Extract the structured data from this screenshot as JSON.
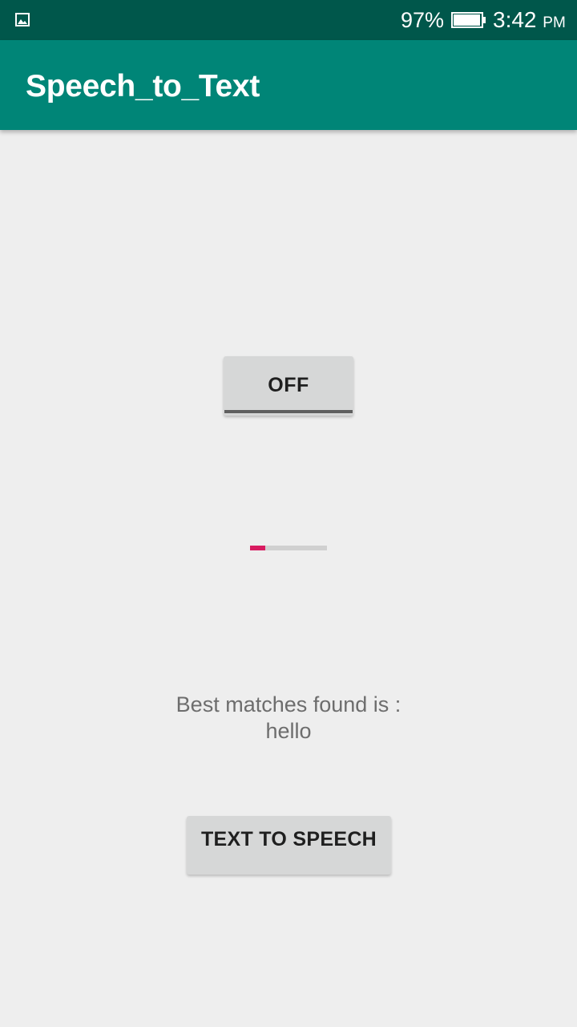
{
  "status_bar": {
    "notification_icon": "image-icon",
    "battery_percent": "97%",
    "battery_level": 0.97,
    "time": "3:42",
    "ampm": "PM"
  },
  "app_bar": {
    "title": "Speech_to_Text",
    "color": "#008577"
  },
  "toggle": {
    "label": "OFF",
    "state": "off"
  },
  "progress": {
    "value": 0.2,
    "color": "#d81b60"
  },
  "result": {
    "label": "Best matches found is :",
    "value": "hello"
  },
  "tts_button": {
    "label": "TEXT TO SPEECH"
  }
}
